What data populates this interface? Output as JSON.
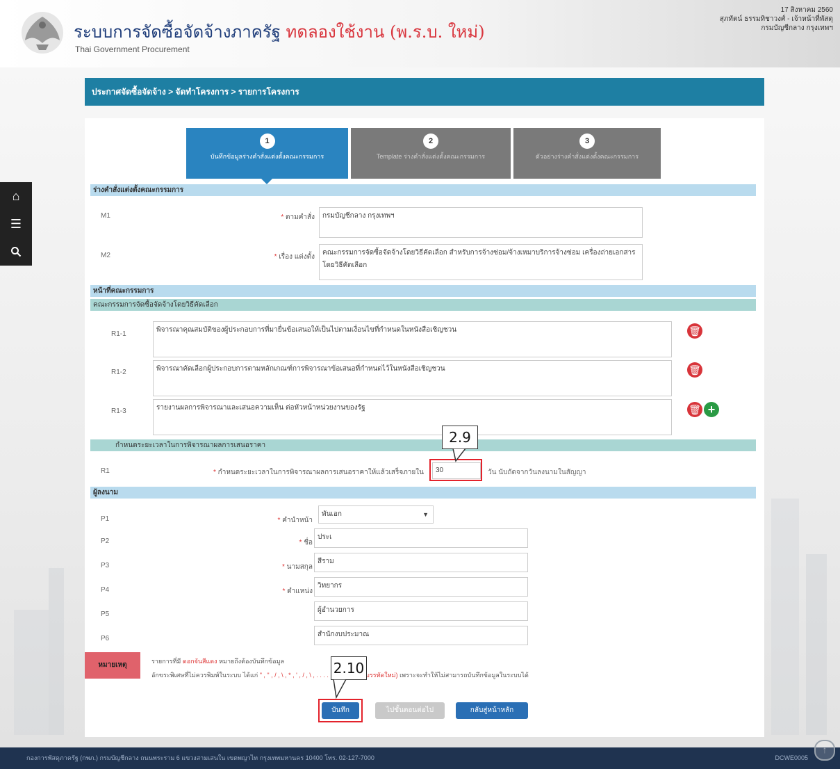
{
  "header": {
    "title": "ระบบการจัดซื้อจัดจ้างภาครัฐ",
    "title_trial": "ทดลองใช้งาน (พ.ร.บ. ใหม่)",
    "subtitle": "Thai Government Procurement",
    "date": "17 สิงหาคม 2560",
    "user": "สุภทัตน์ ธรรมทิชาวงศ์ - เจ้าหน้าที่พัสดุ",
    "org": "กรมบัญชีกลาง กรุงเทพฯ"
  },
  "breadcrumb": "ประกาศจัดซื้อจัดจ้าง > จัดทำโครงการ > รายการโครงการ",
  "sidebar_icons": [
    "home-icon",
    "menu-icon",
    "search-icon"
  ],
  "steps": [
    {
      "num": "1",
      "label": "บันทึกข้อมูลร่างคำสั่งแต่งตั้งคณะกรรมการ"
    },
    {
      "num": "2",
      "label": "Template ร่างคำสั่งแต่งตั้งคณะกรรมการ"
    },
    {
      "num": "3",
      "label": "ตัวอย่างร่างคำสั่งแต่งตั้งคณะกรรมการ"
    }
  ],
  "section_order": {
    "title": "ร่างคำสั่งแต่งตั้งคณะกรรมการ",
    "m1_id": "M1",
    "m1_label": "ตามคำสั่ง",
    "m1_value": "กรมบัญชีกลาง กรุงเทพฯ",
    "m2_id": "M2",
    "m2_label": "เรื่อง แต่งตั้ง",
    "m2_value": "คณะกรรมการจัดซื้อจัดจ้างโดยวิธีคัดเลือก สำหรับการจ้างซ่อม/จ้างเหมาบริการจ้างซ่อม เครื่องถ่ายเอกสาร โดยวิธีคัดเลือก"
  },
  "section_duties": {
    "title": "หน้าที่คณะกรรมการ",
    "subtitle": "คณะกรรมการจัดซื้อจัดจ้างโดยวิธีคัดเลือก",
    "rows": [
      {
        "id": "R1-1",
        "text": "พิจารณาคุณสมบัติของผู้ประกอบการที่มายื่นข้อเสนอให้เป็นไปตามเงื่อนไขที่กำหนดในหนังสือเชิญชวน"
      },
      {
        "id": "R1-2",
        "text": "พิจารณาคัดเลือกผู้ประกอบการตามหลักเกณฑ์การพิจารณาข้อเสนอที่กำหนดไว้ในหนังสือเชิญชวน"
      },
      {
        "id": "R1-3",
        "text": "รายงานผลการพิจารณาและเสนอความเห็น ต่อหัวหน้าหน่วยงานของรัฐ"
      }
    ]
  },
  "section_period": {
    "title": "กำหนดระยะเวลาในการพิจารณาผลการเสนอราคา",
    "id": "R1",
    "label": "กำหนดระยะเวลาในการพิจารณาผลการเสนอราคาให้แล้วเสร็จภายใน",
    "value": "30",
    "suffix": "วัน นับถัดจากวันลงนามในสัญญา"
  },
  "section_signer": {
    "title": "ผู้ลงนาม",
    "fields": [
      {
        "id": "P1",
        "label": "คำนำหน้า",
        "value": "พันเอก",
        "required": true
      },
      {
        "id": "P2",
        "label": "ชื่อ",
        "value": "ประเ",
        "required": true
      },
      {
        "id": "P3",
        "label": "นามสกุล",
        "value": "สีราม",
        "required": true
      },
      {
        "id": "P4",
        "label": "ตำแหน่ง",
        "value": "วิทยากร",
        "required": true
      },
      {
        "id": "P5",
        "label": "",
        "value": "ผู้อำนวยการ",
        "required": false
      },
      {
        "id": "P6",
        "label": "",
        "value": "สำนักงบประมาณ",
        "required": false
      }
    ]
  },
  "note": {
    "tag": "หมายเหตุ",
    "line1_prefix": "รายการที่มี",
    "line1_red": "ดอกจันสีแดง",
    "line1_suffix": "หมายถึงต้องบันทึกข้อมูล",
    "line2_prefix": "อักขระพิเศษที่ไม่ควรพิมพ์ในระบบ ได้แก่",
    "line2_chars": "\" , \" , / , \\ , * , ' , / , \\ , . . . . . ENTER(ขึ้นบรรทัดใหม่)",
    "line2_suffix": "เพราะจะทำให้ไม่สามารถบันทึกข้อมูลในระบบได้"
  },
  "buttons": {
    "save": "บันทึก",
    "next": "ไปขั้นตอนต่อไป",
    "back": "กลับสู่หน้าหลัก"
  },
  "callouts": {
    "c29": "2.9",
    "c210": "2.10"
  },
  "footer": {
    "text": "กองการพัสดุภาครัฐ (กพภ.) กรมบัญชีกลาง ถนนพระราม 6 แขวงสามเสนใน เขตพญาไท กรุงเทพมหานคร 10400 โทร. 02-127-7000",
    "code": "DCWE0005"
  },
  "colors": {
    "accent": "#1e7fa3",
    "red": "#d8343a",
    "green": "#2a9a44",
    "footer": "#1f3350"
  }
}
